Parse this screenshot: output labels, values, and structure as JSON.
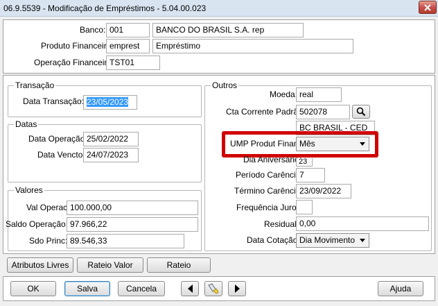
{
  "window": {
    "title": "06.9.5539 - Modificação de Empréstimos - 5.04.00.023"
  },
  "header": {
    "banco_label": "Banco:",
    "banco_code": "001",
    "banco_name": "BANCO DO BRASIL S.A. rep",
    "produto_label": "Produto Financeiro:",
    "produto_code": "emprest",
    "produto_name": "Empréstimo",
    "operacao_label": "Operação Financeira:",
    "operacao_code": "TST01"
  },
  "transacao": {
    "legend": "Transação",
    "data_label": "Data Transação:",
    "data_value": "23/05/2023"
  },
  "datas": {
    "legend": "Datas",
    "operacao_label": "Data Operação:",
    "operacao_value": "25/02/2022",
    "vencto_label": "Data Vencto:",
    "vencto_value": "24/07/2023"
  },
  "valores": {
    "legend": "Valores",
    "val_operac_label": "Val Operac:",
    "val_operac_value": "100.000,00",
    "saldo_label": "Saldo Operação:",
    "saldo_value": "97.966,22",
    "sdo_princ_label": "Sdo Princ:",
    "sdo_princ_value": "89.546,33"
  },
  "outros": {
    "legend": "Outros",
    "moeda_label": "Moeda:",
    "moeda_value": "real",
    "cta_label": "Cta Corrente Padrão:",
    "cta_value": "502078",
    "cta_name": "BC BRASIL - CED",
    "ump_label": "UMP Produt Financ:",
    "ump_value": "Mês",
    "dia_aniv_label": "Dia Aniversário:",
    "dia_aniv_value": "23",
    "periodo_label": "Período Carência:",
    "periodo_value": "7",
    "termino_label": "Término Carência:",
    "termino_value": "23/09/2022",
    "freq_label": "Frequência Juros:",
    "freq_value": "",
    "residual_label": "Residual:",
    "residual_value": "0,00",
    "cotacao_label": "Data Cotação:",
    "cotacao_value": "Dia Movimento"
  },
  "tabs_buttons": {
    "atributos": "Atributos Livres",
    "rateio_valor": "Rateio Valor",
    "rateio": "Rateio"
  },
  "footer": {
    "ok": "OK",
    "salva": "Salva",
    "cancela": "Cancela",
    "ajuda": "Ajuda"
  },
  "colors": {
    "highlight": "#d10000",
    "selection": "#3399ff"
  }
}
